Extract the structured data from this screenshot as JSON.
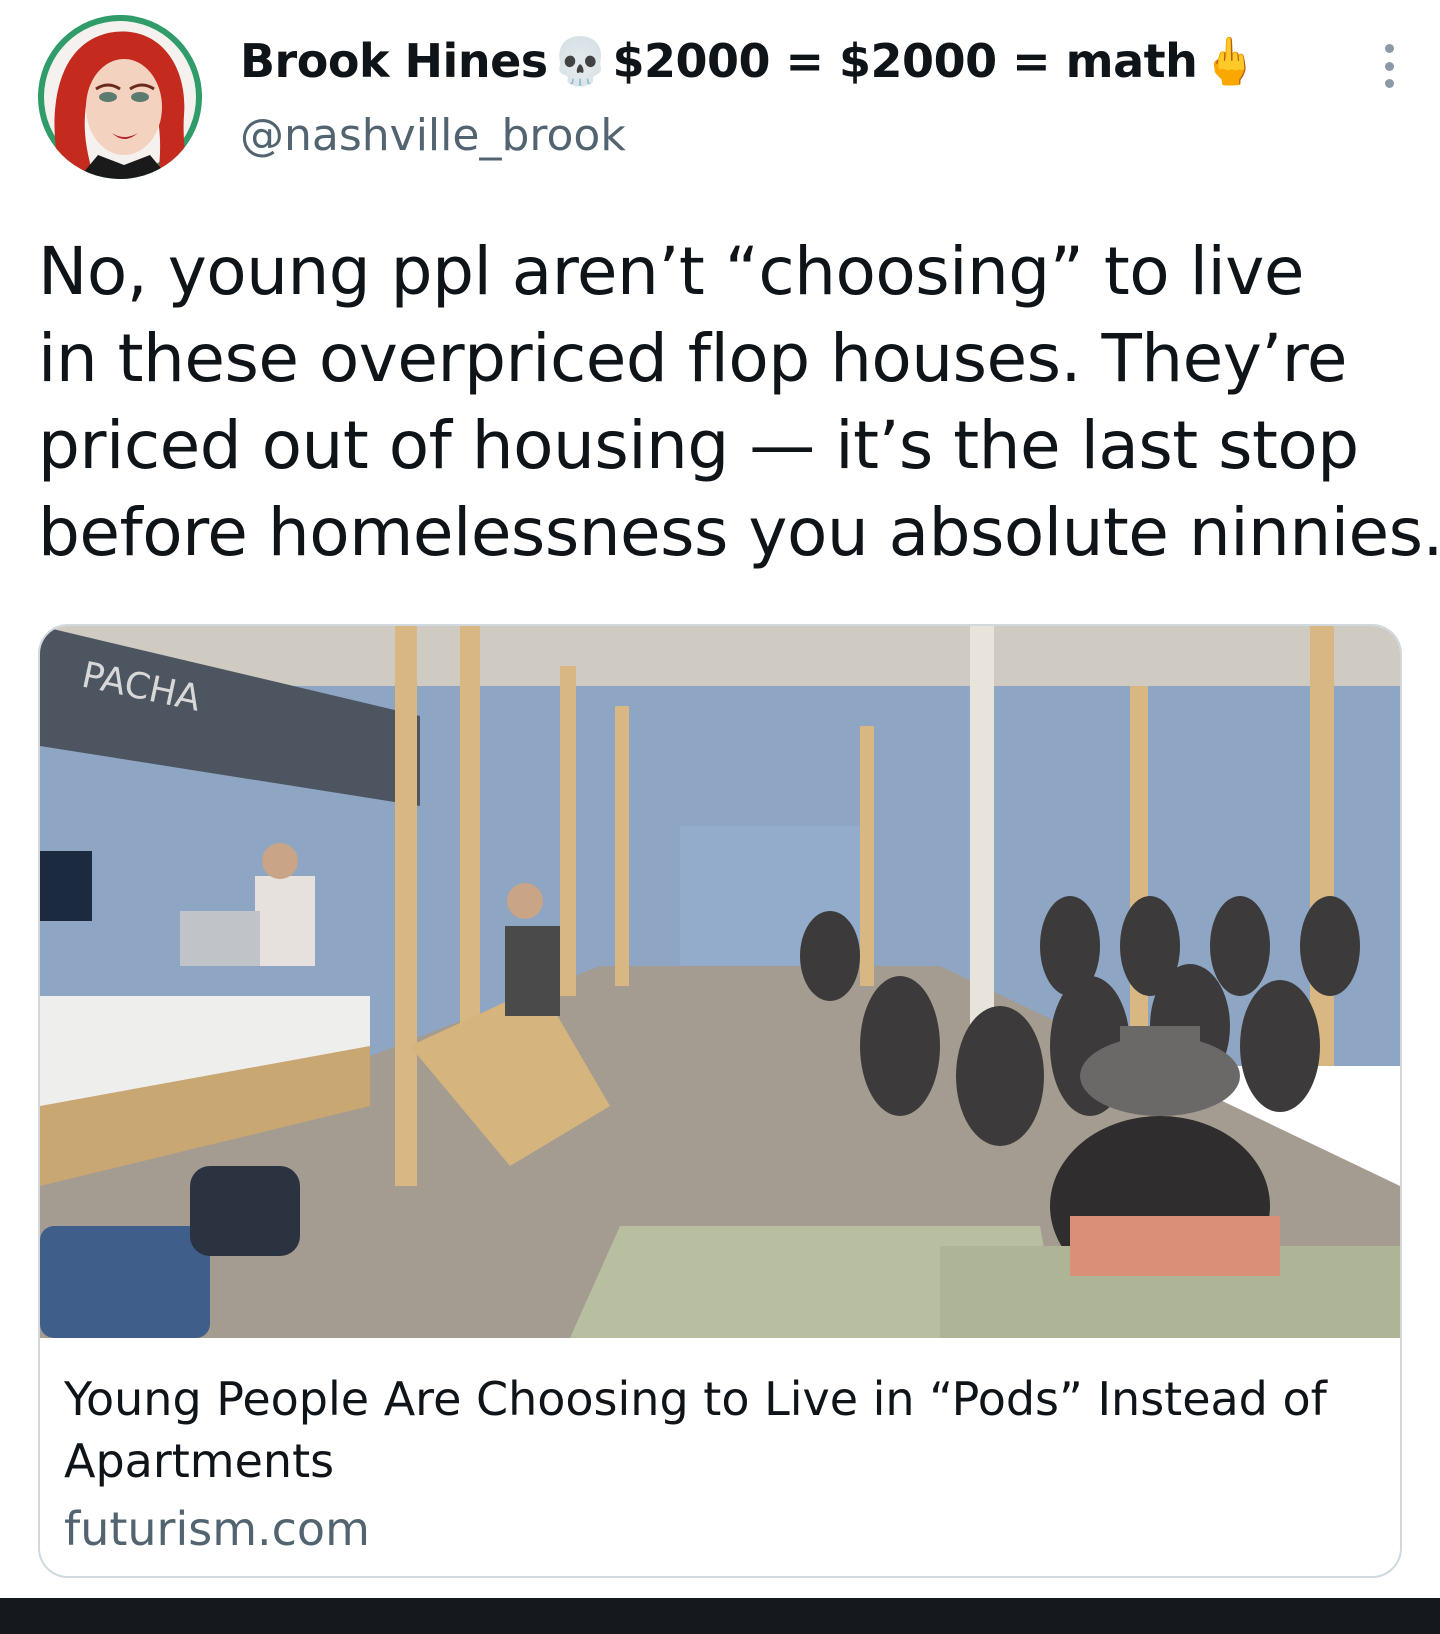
{
  "tweet": {
    "author": {
      "display_name": "Brook Hines",
      "name_suffix": "$2000 = $2000 = math",
      "emoji_skull": "💀",
      "emoji_finger": "🖕",
      "handle": "@nashville_brook",
      "avatar_ring_color": "#2f9c6a"
    },
    "text_lines": [
      "No, young ppl aren’t “choosing” to live",
      "in these overpriced flop houses. They’re",
      "priced out of housing — it’s the last stop",
      "before homelessness you absolute ninnies."
    ],
    "more_icon": "more-vertical-icon",
    "link_card": {
      "image_alt_scene": "photo",
      "image_sign_text": "PACHA",
      "title_line1": "Young People Are Choosing to Live in “Pods” Instead of",
      "title_line2": "Apartments",
      "domain": "futurism.com"
    }
  },
  "colors": {
    "text_primary": "#0f1419",
    "text_secondary": "#536471",
    "card_border": "#cfd9de",
    "bottom_bar": "#15181c"
  }
}
